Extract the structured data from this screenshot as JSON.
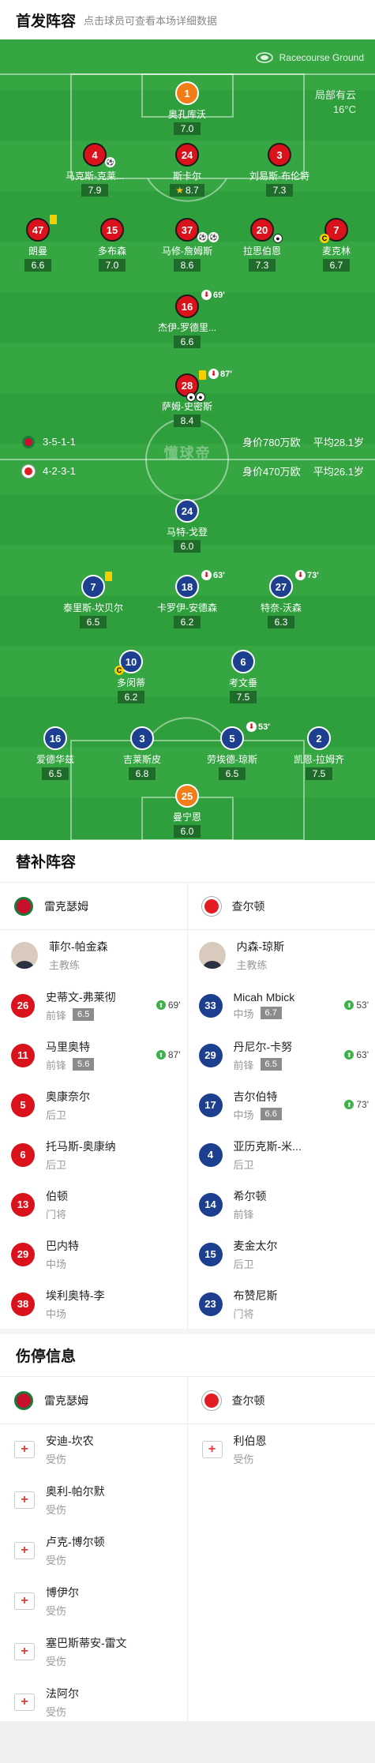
{
  "header": {
    "title": "首发阵容",
    "subtitle": "点击球员可查看本场详细数据"
  },
  "pitch": {
    "venue": "Racecourse Ground",
    "weather_line1": "局部有云",
    "weather_line2": "16°C",
    "watermark": "懂球帝"
  },
  "home_lineup": {
    "formation": "3-5-1-1",
    "market_value": "身价780万欧",
    "avg_age": "平均28.1岁",
    "players": [
      {
        "num": "1",
        "name": "奥孔库沃",
        "rating": "7.0",
        "pos": "gk"
      },
      {
        "num": "4",
        "name": "马克斯-克莱...",
        "rating": "7.9"
      },
      {
        "num": "24",
        "name": "斯卡尔",
        "rating": "8.7",
        "star": true
      },
      {
        "num": "3",
        "name": "刘易斯-布伦特",
        "rating": "7.3"
      },
      {
        "num": "47",
        "name": "朗曼",
        "rating": "6.6"
      },
      {
        "num": "15",
        "name": "多布森",
        "rating": "7.0"
      },
      {
        "num": "37",
        "name": "马修-詹姆斯",
        "rating": "8.6"
      },
      {
        "num": "20",
        "name": "拉思伯恩",
        "rating": "7.3"
      },
      {
        "num": "7",
        "name": "麦克林",
        "rating": "6.7"
      },
      {
        "num": "16",
        "name": "杰伊-罗德里...",
        "rating": "6.6",
        "sub": "69'"
      },
      {
        "num": "28",
        "name": "萨姆-史密斯",
        "rating": "8.4",
        "sub": "87'"
      }
    ]
  },
  "away_lineup": {
    "formation": "4-2-3-1",
    "market_value": "身价470万欧",
    "avg_age": "平均26.1岁",
    "players": [
      {
        "num": "24",
        "name": "马特-戈登",
        "rating": "6.0"
      },
      {
        "num": "7",
        "name": "泰里斯-坎贝尔",
        "rating": "6.5"
      },
      {
        "num": "18",
        "name": "卡罗伊-安德森",
        "rating": "6.2",
        "sub": "63'"
      },
      {
        "num": "27",
        "name": "特奈-沃森",
        "rating": "6.3",
        "sub": "73'"
      },
      {
        "num": "10",
        "name": "多闵蒂",
        "rating": "6.2"
      },
      {
        "num": "6",
        "name": "考文垂",
        "rating": "7.5"
      },
      {
        "num": "16",
        "name": "爱德华兹",
        "rating": "6.5"
      },
      {
        "num": "3",
        "name": "吉莱斯皮",
        "rating": "6.8"
      },
      {
        "num": "5",
        "name": "劳埃德-琼斯",
        "rating": "6.5",
        "sub": "53'"
      },
      {
        "num": "2",
        "name": "凯恩-拉姆齐",
        "rating": "7.5"
      },
      {
        "num": "25",
        "name": "曼宁恩",
        "rating": "6.0",
        "pos": "gk"
      }
    ]
  },
  "subs": {
    "title": "替补阵容",
    "home_team": "雷克瑟姆",
    "away_team": "查尔顿",
    "home_manager": {
      "name": "菲尔-帕金森",
      "role": "主教练"
    },
    "away_manager": {
      "name": "内森-琼斯",
      "role": "主教练"
    },
    "home": [
      {
        "num": "26",
        "name": "史蒂文-弗莱彻",
        "pos": "前锋",
        "rating": "6.5",
        "in": "69'"
      },
      {
        "num": "11",
        "name": "马里奥特",
        "pos": "前锋",
        "rating": "5.6",
        "in": "87'"
      },
      {
        "num": "5",
        "name": "奥康奈尔",
        "pos": "后卫"
      },
      {
        "num": "6",
        "name": "托马斯-奥康纳",
        "pos": "后卫"
      },
      {
        "num": "13",
        "name": "伯顿",
        "pos": "门将"
      },
      {
        "num": "29",
        "name": "巴内特",
        "pos": "中场"
      },
      {
        "num": "38",
        "name": "埃利奥特-李",
        "pos": "中场"
      }
    ],
    "away": [
      {
        "num": "33",
        "name": "Micah Mbick",
        "pos": "中场",
        "rating": "6.7",
        "in": "53'"
      },
      {
        "num": "29",
        "name": "丹尼尔-卡努",
        "pos": "前锋",
        "rating": "6.5",
        "in": "63'"
      },
      {
        "num": "17",
        "name": "吉尔伯特",
        "pos": "中场",
        "rating": "6.6",
        "in": "73'"
      },
      {
        "num": "4",
        "name": "亚历克斯-米...",
        "pos": "后卫"
      },
      {
        "num": "14",
        "name": "希尔顿",
        "pos": "前锋"
      },
      {
        "num": "15",
        "name": "麦金太尔",
        "pos": "后卫"
      },
      {
        "num": "23",
        "name": "布赞尼斯",
        "pos": "门将"
      }
    ]
  },
  "injuries": {
    "title": "伤停信息",
    "home_team": "雷克瑟姆",
    "away_team": "查尔顿",
    "home": [
      {
        "name": "安迪-坎农",
        "status": "受伤"
      },
      {
        "name": "奥利-帕尔默",
        "status": "受伤"
      },
      {
        "name": "卢克-博尔顿",
        "status": "受伤"
      },
      {
        "name": "博伊尔",
        "status": "受伤"
      },
      {
        "name": "塞巴斯蒂安-雷文",
        "status": "受伤"
      },
      {
        "name": "法阿尔",
        "status": "受伤"
      }
    ],
    "away": [
      {
        "name": "利伯恩",
        "status": "受伤"
      }
    ]
  },
  "colors": {
    "pitch": "#2f9e3c",
    "home": "#d9121b",
    "away": "#1d3f8f",
    "gk_home": "#f07d18"
  }
}
